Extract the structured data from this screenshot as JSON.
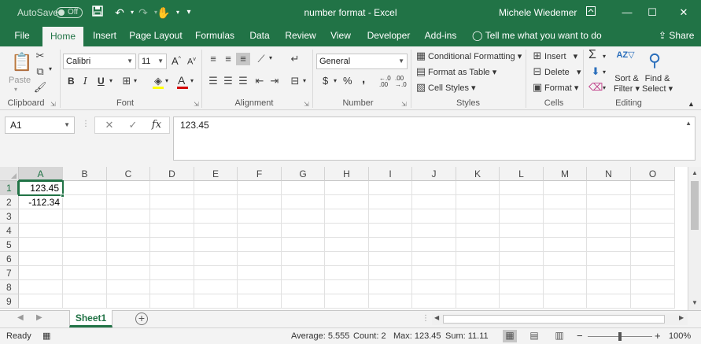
{
  "titlebar": {
    "autosave_label": "AutoSave",
    "autosave_state": "Off",
    "doc_title": "number format  -  Excel",
    "user": "Michele Wiedemer",
    "icons": [
      "save-icon",
      "undo-icon",
      "redo-icon",
      "touch-mode-icon",
      "customize-qat-icon",
      "ribbon-display-icon",
      "minimize-icon",
      "maximize-icon",
      "close-icon"
    ]
  },
  "tabs": [
    "File",
    "Home",
    "Insert",
    "Page Layout",
    "Formulas",
    "Data",
    "Review",
    "View",
    "Developer",
    "Add-ins"
  ],
  "active_tab": "Home",
  "tellme": "Tell me what you want to do",
  "share": "Share",
  "ribbon": {
    "clipboard": {
      "paste": "Paste",
      "label": "Clipboard"
    },
    "font": {
      "name": "Calibri",
      "size": "11",
      "bold": "B",
      "italic": "I",
      "underline": "U",
      "label": "Font",
      "font_color": "#d40000"
    },
    "alignment": {
      "label": "Alignment"
    },
    "number": {
      "format": "General",
      "currency": "$",
      "percent": "%",
      "comma": ",",
      "label": "Number"
    },
    "styles": {
      "conditional": "Conditional Formatting",
      "format_table": "Format as Table",
      "cell_styles": "Cell Styles",
      "label": "Styles"
    },
    "cells": {
      "insert": "Insert",
      "delete": "Delete",
      "format": "Format",
      "label": "Cells"
    },
    "editing": {
      "sort_filter_1": "Sort &",
      "sort_filter_2": "Filter",
      "find_select_1": "Find &",
      "find_select_2": "Select",
      "label": "Editing",
      "sigma": "Σ"
    }
  },
  "formula_bar": {
    "name_box": "A1",
    "cancel": "✕",
    "enter": "✓",
    "fx": "fx",
    "content": "123.45"
  },
  "grid": {
    "columns": [
      "A",
      "B",
      "C",
      "D",
      "E",
      "F",
      "G",
      "H",
      "I",
      "J",
      "K",
      "L",
      "M",
      "N",
      "O"
    ],
    "rows": [
      "1",
      "2",
      "3",
      "4",
      "5",
      "6",
      "7",
      "8",
      "9"
    ],
    "cells": {
      "A1": "123.45",
      "A2": "-112.34"
    },
    "active_cell": "A1"
  },
  "sheets": [
    "Sheet1"
  ],
  "status": {
    "ready": "Ready",
    "average": "Average: 5.555",
    "count": "Count: 2",
    "max": "Max: 123.45",
    "sum": "Sum: 11.11",
    "zoom": "100%",
    "minus": "−",
    "plus": "+"
  },
  "colors": {
    "accent": "#217346",
    "ribbon_bg": "#f3f3f3"
  }
}
